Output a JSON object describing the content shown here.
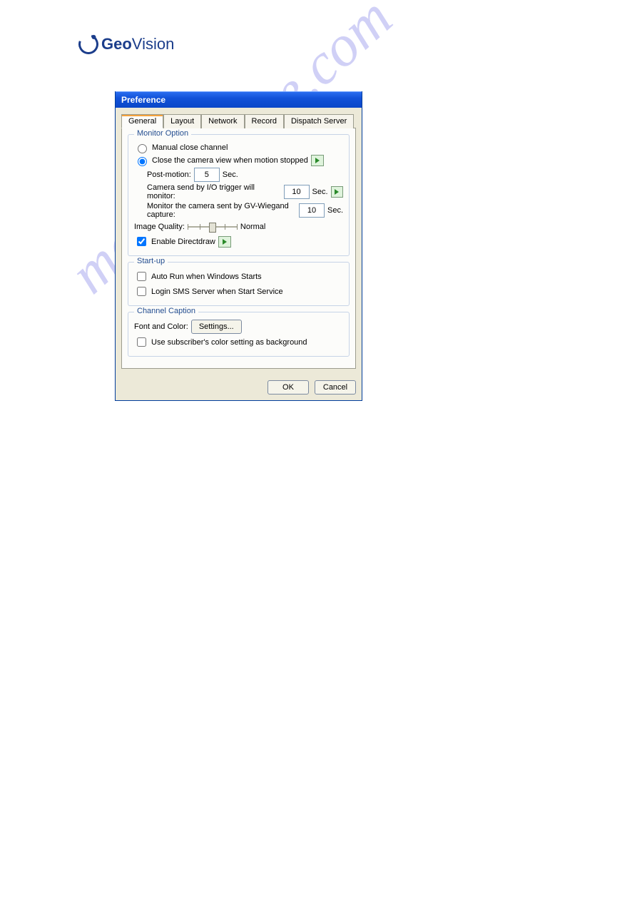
{
  "logo": {
    "geo": "Geo",
    "vision": "Vision"
  },
  "watermark": "manualshive.com",
  "dialog": {
    "title": "Preference",
    "tabs": {
      "general": "General",
      "layout": "Layout",
      "network": "Network",
      "record": "Record",
      "dispatch": "Dispatch Server"
    },
    "monitor": {
      "legend": "Monitor Option",
      "manual_close": "Manual close channel",
      "close_when_motion": "Close the camera view when motion stopped",
      "post_motion_label": "Post-motion:",
      "post_motion_val": "5",
      "sec": "Sec.",
      "io_trigger_label": "Camera send by I/O trigger will monitor:",
      "io_trigger_val": "10",
      "wiegand_label": "Monitor the camera sent by GV-Wiegand capture:",
      "wiegand_val": "10",
      "image_quality_label": "Image Quality:",
      "image_quality_value": "Normal",
      "enable_directdraw": "Enable Directdraw"
    },
    "startup": {
      "legend": "Start-up",
      "auto_run": "Auto Run when Windows Starts",
      "login_sms": "Login SMS Server when Start Service"
    },
    "caption": {
      "legend": "Channel Caption",
      "font_label": "Font and Color:",
      "settings_btn": "Settings...",
      "use_subscriber_color": "Use subscriber's color setting as background"
    },
    "buttons": {
      "ok": "OK",
      "cancel": "Cancel"
    }
  }
}
